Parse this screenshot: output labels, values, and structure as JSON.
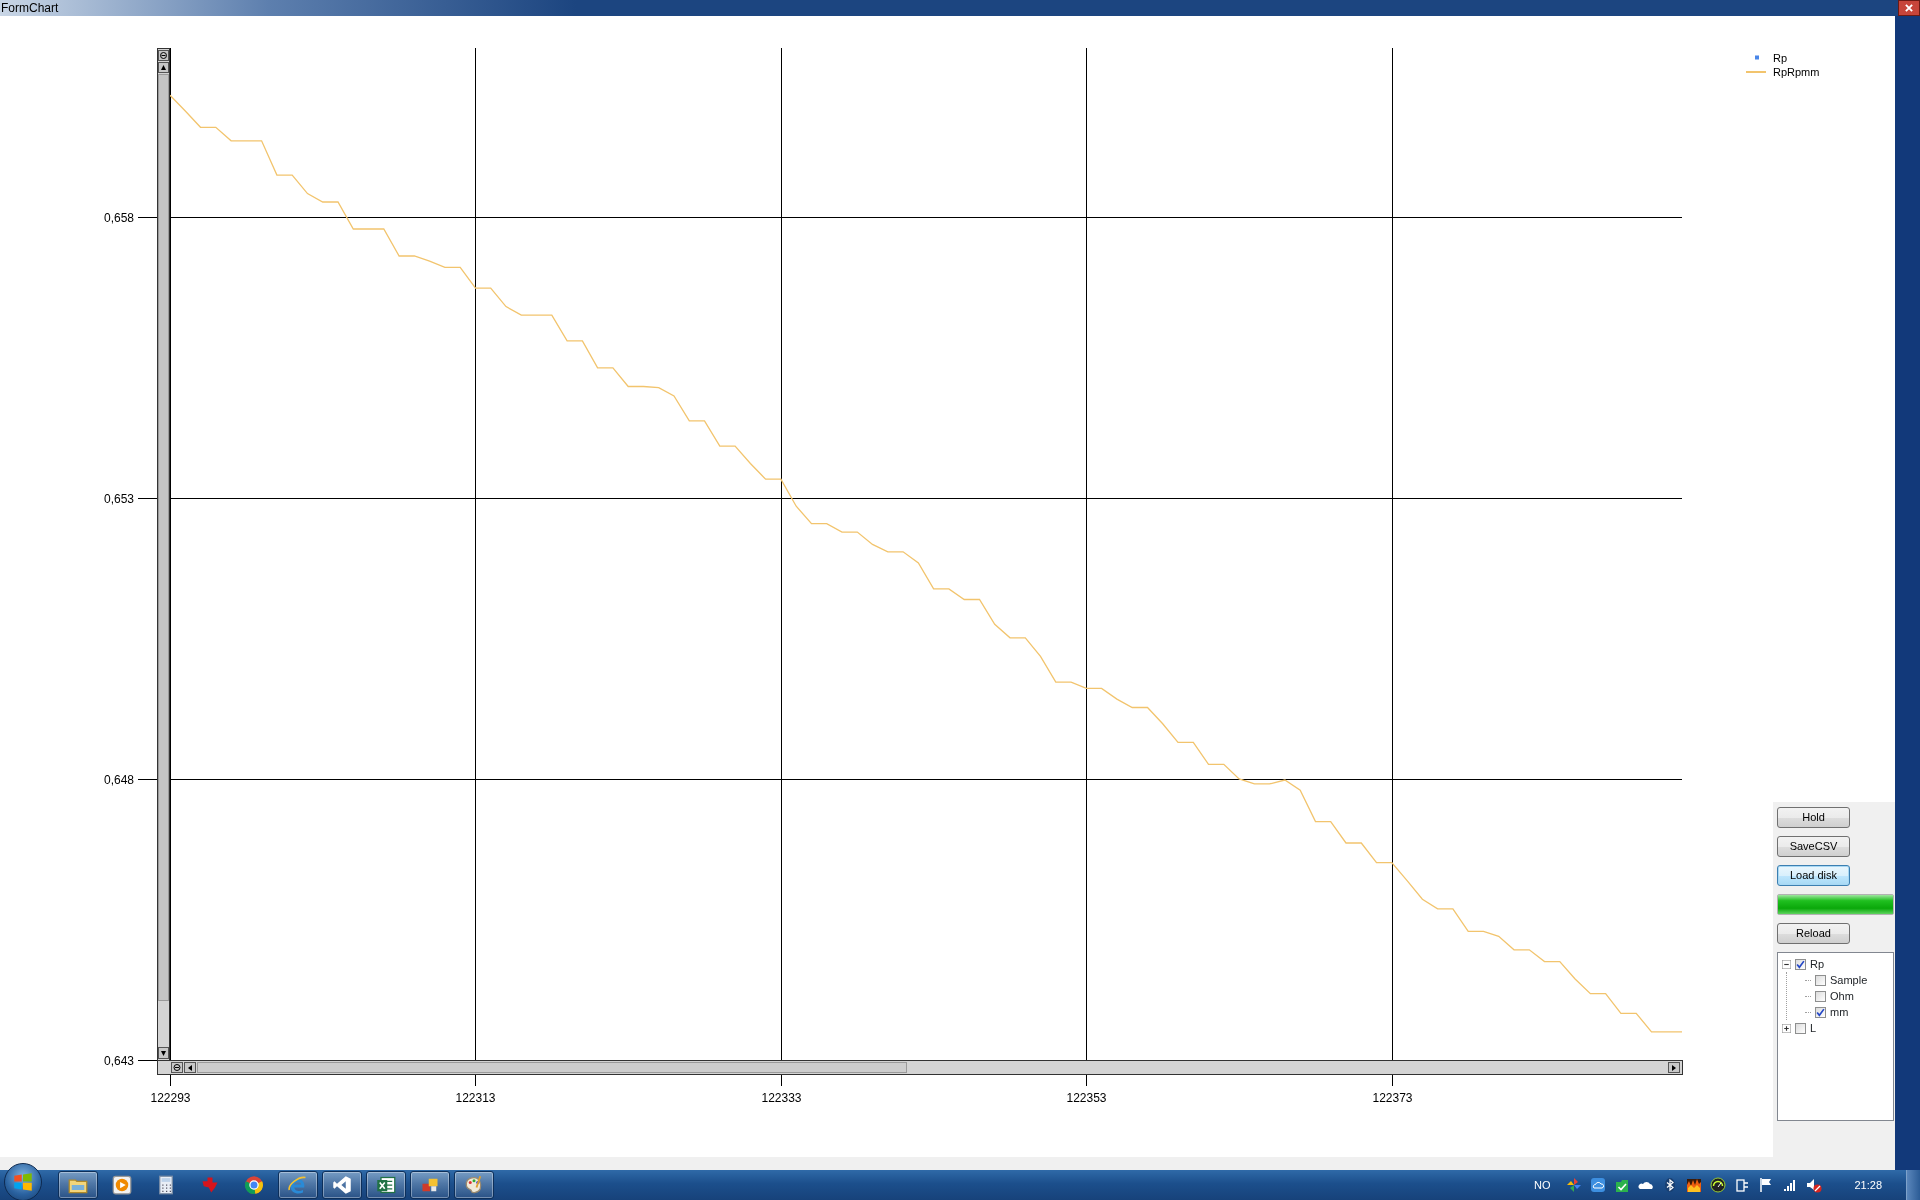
{
  "window": {
    "title": "FormChart"
  },
  "chart": {
    "chart_data": {
      "type": "line",
      "x": [
        122293,
        122294,
        122295,
        122296,
        122297,
        122298,
        122299,
        122300,
        122301,
        122302,
        122303,
        122304,
        122305,
        122306,
        122307,
        122308,
        122309,
        122310,
        122311,
        122312,
        122313,
        122314,
        122315,
        122316,
        122317,
        122318,
        122319,
        122320,
        122321,
        122322,
        122323,
        122324,
        122325,
        122326,
        122327,
        122328,
        122329,
        122330,
        122331,
        122332,
        122333,
        122334,
        122335,
        122336,
        122337,
        122338,
        122339,
        122340,
        122341,
        122342,
        122343,
        122344,
        122345,
        122346,
        122347,
        122348,
        122349,
        122350,
        122351,
        122352,
        122353,
        122354,
        122355,
        122356,
        122357,
        122358,
        122359,
        122360,
        122361,
        122362,
        122363,
        122364,
        122365,
        122366,
        122367,
        122368,
        122369,
        122370,
        122371,
        122372,
        122373,
        122374,
        122375,
        122376,
        122377,
        122378,
        122379,
        122380,
        122381,
        122382,
        122383,
        122384,
        122385,
        122386,
        122387,
        122388,
        122389,
        122390,
        122391,
        122392
      ],
      "series": [
        {
          "name": "Rp",
          "color": "#4a86e8",
          "values": [
            null,
            null,
            null,
            null,
            null,
            null,
            null,
            null,
            null,
            null,
            null,
            null,
            null,
            null,
            null,
            null,
            null,
            null,
            null,
            null,
            null,
            null,
            null,
            null,
            null,
            null,
            null,
            null,
            null,
            null,
            null,
            null,
            null,
            null,
            null,
            null,
            null,
            null,
            null,
            null,
            null,
            null,
            null,
            null,
            null,
            null,
            null,
            null,
            null,
            null,
            null,
            null,
            null,
            null,
            null,
            null,
            null,
            null,
            null,
            null,
            null,
            null,
            null,
            null,
            null,
            null,
            null,
            null,
            null,
            null,
            null,
            null,
            null,
            null,
            null,
            null,
            null,
            null,
            null,
            null,
            null,
            null,
            null,
            null,
            null,
            null,
            null,
            null,
            null,
            null,
            null,
            null,
            null,
            null,
            null,
            null,
            null,
            null,
            null,
            null
          ]
        },
        {
          "name": "RpRpmm",
          "color": "#f2c46d",
          "values": [
            0.66016,
            0.65988,
            0.65959,
            0.65959,
            0.65935,
            0.65935,
            0.65935,
            0.65874,
            0.65874,
            0.65841,
            0.65826,
            0.65826,
            0.65778,
            0.65778,
            0.65778,
            0.6573,
            0.6573,
            0.65721,
            0.6571,
            0.6571,
            0.65673,
            0.65673,
            0.6564,
            0.65625,
            0.65625,
            0.65625,
            0.65579,
            0.65579,
            0.65531,
            0.65531,
            0.65498,
            0.65498,
            0.65496,
            0.65481,
            0.65437,
            0.65437,
            0.65392,
            0.65392,
            0.65361,
            0.65333,
            0.65333,
            0.65285,
            0.65254,
            0.65254,
            0.65239,
            0.65239,
            0.65217,
            0.65204,
            0.65204,
            0.65184,
            0.65138,
            0.65138,
            0.65119,
            0.65119,
            0.65075,
            0.65051,
            0.65051,
            0.65018,
            0.64972,
            0.64972,
            0.64961,
            0.64961,
            0.64942,
            0.64927,
            0.64927,
            0.64898,
            0.64865,
            0.64865,
            0.64826,
            0.64826,
            0.648,
            0.64791,
            0.64791,
            0.64798,
            0.6478,
            0.64724,
            0.64724,
            0.64686,
            0.64686,
            0.64651,
            0.64651,
            0.64619,
            0.64586,
            0.64569,
            0.64569,
            0.64529,
            0.64529,
            0.6452,
            0.64496,
            0.64496,
            0.64475,
            0.64475,
            0.64444,
            0.64418,
            0.64418,
            0.64383,
            0.64383,
            0.6435,
            0.6435,
            0.6435
          ]
        }
      ],
      "grid": true,
      "xlim": [
        122293,
        122392
      ],
      "ylim": [
        0.643,
        0.661
      ],
      "xticks": [
        122293,
        122313,
        122333,
        122353,
        122373
      ],
      "yticks": [
        {
          "value": 0.643,
          "label": "0,643"
        },
        {
          "value": 0.648,
          "label": "0,648"
        },
        {
          "value": 0.653,
          "label": "0,653"
        },
        {
          "value": 0.658,
          "label": "0,658"
        }
      ]
    },
    "legend": [
      {
        "kind": "point"
      },
      {
        "kind": "line"
      }
    ]
  },
  "panel": {
    "buttons": [
      {
        "label": "Hold",
        "focused": false
      },
      {
        "label": "SaveCSV",
        "focused": false
      },
      {
        "label": "Load disk",
        "focused": true
      }
    ],
    "progress": {
      "level": 1
    },
    "reload_button": {
      "label": "Reload",
      "focused": false
    },
    "tree": [
      {
        "label": "Rp",
        "checked": true,
        "expanded": true,
        "children": [
          {
            "label": "Sample",
            "checked": false
          },
          {
            "label": "Ohm",
            "checked": false
          },
          {
            "label": "mm",
            "checked": true
          }
        ]
      },
      {
        "label": "L",
        "checked": false,
        "expanded": false
      }
    ]
  },
  "taskbar": {
    "apps": [
      {
        "kind": "folder",
        "running": true
      },
      {
        "kind": "media",
        "running": false
      },
      {
        "kind": "calculator",
        "running": false
      },
      {
        "kind": "emblem",
        "running": false
      },
      {
        "kind": "ring",
        "running": false
      },
      {
        "kind": "e-logo",
        "running": true
      },
      {
        "kind": "infinity",
        "running": true
      },
      {
        "kind": "sheet",
        "running": true
      },
      {
        "kind": "squares",
        "running": true
      },
      {
        "kind": "palette",
        "running": true
      }
    ],
    "tray": {
      "language": "NO",
      "icons": [
        {
          "kind": "pinwheel"
        },
        {
          "kind": "cloud-box"
        },
        {
          "kind": "check"
        },
        {
          "kind": "cloud"
        },
        {
          "kind": "bluetooth"
        },
        {
          "kind": "flame"
        },
        {
          "kind": "gauge"
        },
        {
          "kind": "plug"
        },
        {
          "kind": "flag"
        },
        {
          "kind": "signal"
        },
        {
          "kind": "speaker-muted"
        }
      ],
      "clock": "21:28"
    }
  }
}
